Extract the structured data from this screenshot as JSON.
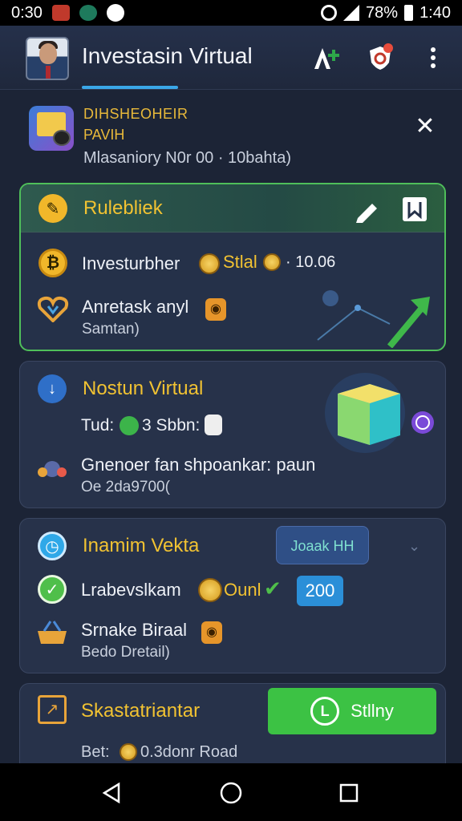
{
  "status_bar": {
    "time_left": "0:30",
    "battery": "78%",
    "time_right": "1:40"
  },
  "app_bar": {
    "title": "Investasin Virtual"
  },
  "notice": {
    "line1": "DIHSHEOHEIR",
    "line2": "PAVIH",
    "line3": "Mlasaniory N0r 00 · 10bahta)"
  },
  "card1": {
    "header": "Rulebliek",
    "row1_label": "Investurbher",
    "row1_value": "Stlal",
    "row1_amount": "· 10.06",
    "row2_title": "Anretask anyl",
    "row2_sub": "Samtan)"
  },
  "card2": {
    "title": "Nostun Virtual",
    "row1_label": "Tud:",
    "row1_value": "3 Sbbn:",
    "row2_title": "Gnenoer fan shpoankar: paun",
    "row2_sub": "Oe 2da9700("
  },
  "card3": {
    "title": "Inamim Vekta",
    "join_label": "Joaak HH",
    "row1_label": "Lrabevslkam",
    "row1_value": "Ounl",
    "row1_chip": "200",
    "row2_title": "Srnake Biraal",
    "row2_sub": "Bedo Dretail)"
  },
  "card4": {
    "title": "Skastatriantar",
    "row1_label": "Bet:",
    "row1_value": "0.3donr Road",
    "button_label": "Stllny"
  },
  "colors": {
    "accent_yellow": "#f1c232",
    "accent_green": "#3cc244",
    "accent_blue": "#3aa7e8",
    "background": "#1c2436"
  }
}
